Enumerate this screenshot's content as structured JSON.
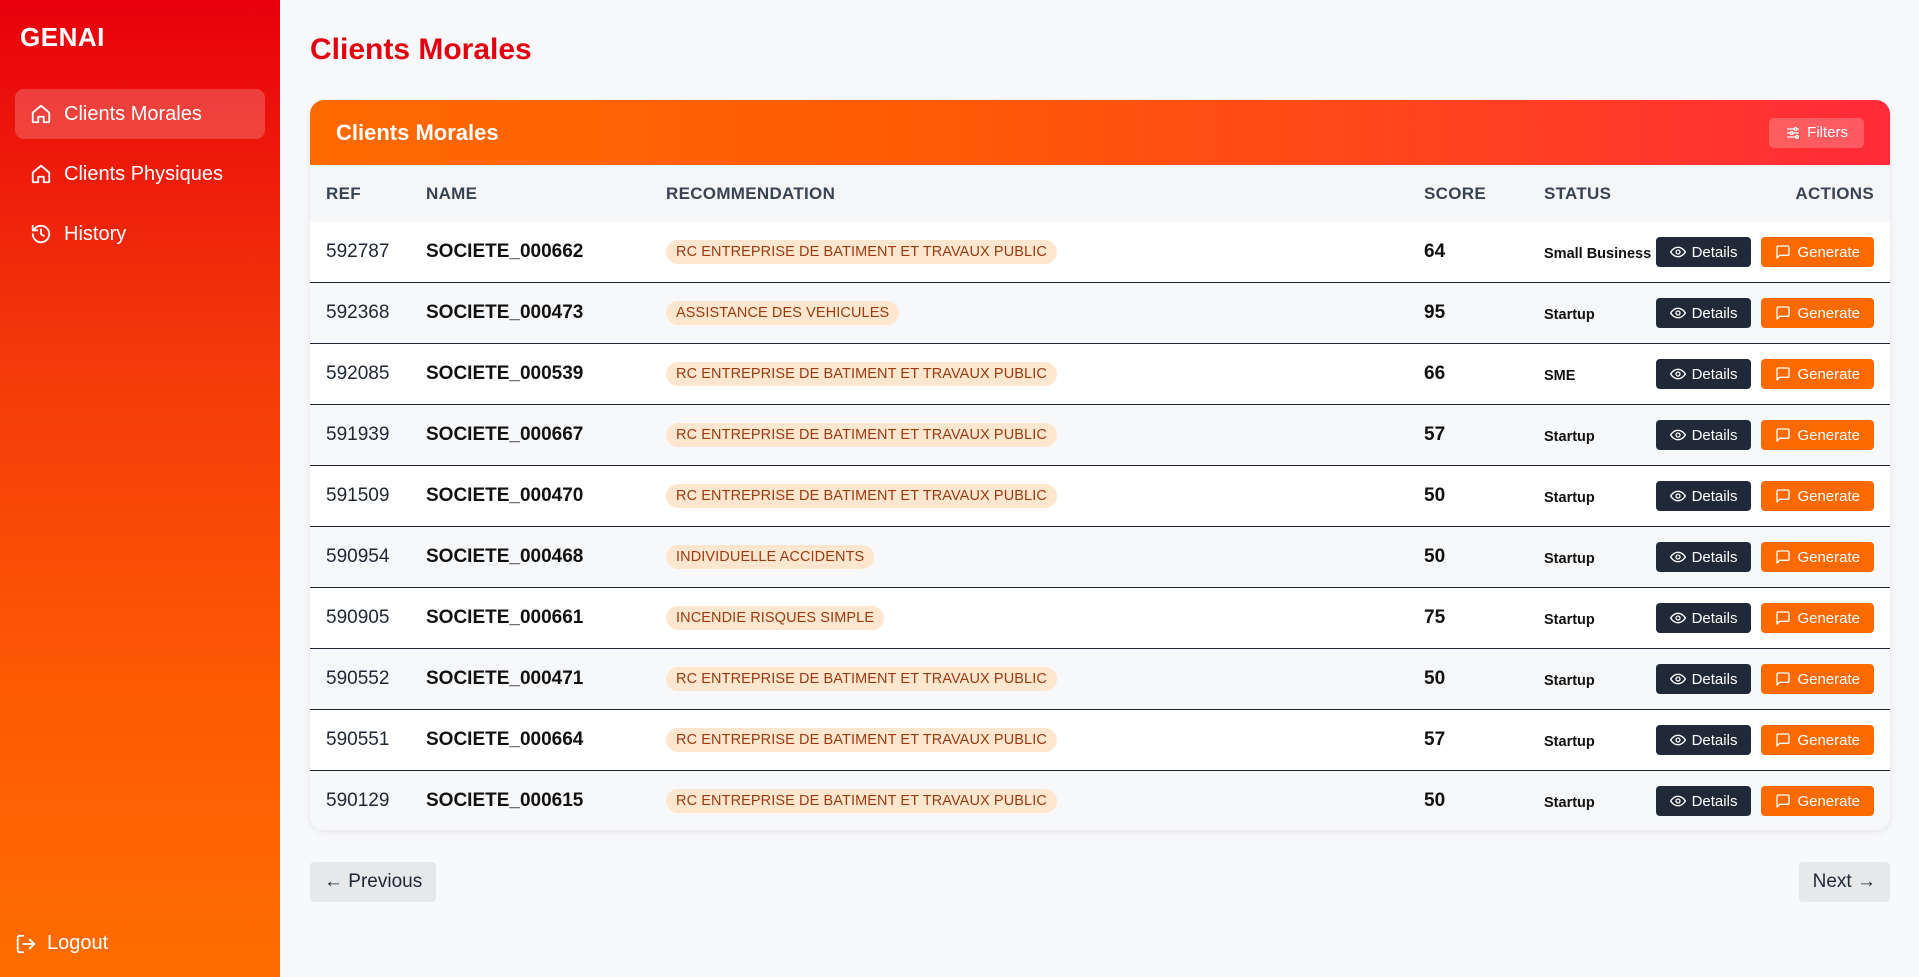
{
  "sidebar": {
    "brand": "GENAI",
    "items": [
      {
        "label": "Clients Morales",
        "icon": "home-icon",
        "active": true
      },
      {
        "label": "Clients Physiques",
        "icon": "home-icon",
        "active": false
      },
      {
        "label": "History",
        "icon": "history-icon",
        "active": false
      }
    ],
    "logout": "Logout"
  },
  "page": {
    "title": "Clients Morales"
  },
  "card": {
    "title": "Clients Morales",
    "filters_label": "Filters"
  },
  "table": {
    "columns": [
      "REF",
      "NAME",
      "RECOMMENDATION",
      "SCORE",
      "STATUS",
      "ACTIONS"
    ],
    "details_label": "Details",
    "generate_label": "Generate",
    "rows": [
      {
        "ref": "592787",
        "name": "SOCIETE_000662",
        "recommendation": "RC ENTREPRISE DE BATIMENT ET TRAVAUX PUBLIC",
        "score": "64",
        "status": "Small Business"
      },
      {
        "ref": "592368",
        "name": "SOCIETE_000473",
        "recommendation": "ASSISTANCE DES VEHICULES",
        "score": "95",
        "status": "Startup"
      },
      {
        "ref": "592085",
        "name": "SOCIETE_000539",
        "recommendation": "RC ENTREPRISE DE BATIMENT ET TRAVAUX PUBLIC",
        "score": "66",
        "status": "SME"
      },
      {
        "ref": "591939",
        "name": "SOCIETE_000667",
        "recommendation": "RC ENTREPRISE DE BATIMENT ET TRAVAUX PUBLIC",
        "score": "57",
        "status": "Startup"
      },
      {
        "ref": "591509",
        "name": "SOCIETE_000470",
        "recommendation": "RC ENTREPRISE DE BATIMENT ET TRAVAUX PUBLIC",
        "score": "50",
        "status": "Startup"
      },
      {
        "ref": "590954",
        "name": "SOCIETE_000468",
        "recommendation": "INDIVIDUELLE ACCIDENTS",
        "score": "50",
        "status": "Startup"
      },
      {
        "ref": "590905",
        "name": "SOCIETE_000661",
        "recommendation": "INCENDIE RISQUES SIMPLE",
        "score": "75",
        "status": "Startup"
      },
      {
        "ref": "590552",
        "name": "SOCIETE_000471",
        "recommendation": "RC ENTREPRISE DE BATIMENT ET TRAVAUX PUBLIC",
        "score": "50",
        "status": "Startup"
      },
      {
        "ref": "590551",
        "name": "SOCIETE_000664",
        "recommendation": "RC ENTREPRISE DE BATIMENT ET TRAVAUX PUBLIC",
        "score": "57",
        "status": "Startup"
      },
      {
        "ref": "590129",
        "name": "SOCIETE_000615",
        "recommendation": "RC ENTREPRISE DE BATIMENT ET TRAVAUX PUBLIC",
        "score": "50",
        "status": "Startup"
      }
    ]
  },
  "pagination": {
    "previous_label": "← Previous",
    "next_label": "Next →"
  },
  "colors": {
    "brand_red": "#e3000f",
    "accent_orange": "#ff6a00",
    "dark_button": "#1f2937",
    "badge_bg": "#ffe7cf",
    "badge_text": "#9a3b12"
  }
}
